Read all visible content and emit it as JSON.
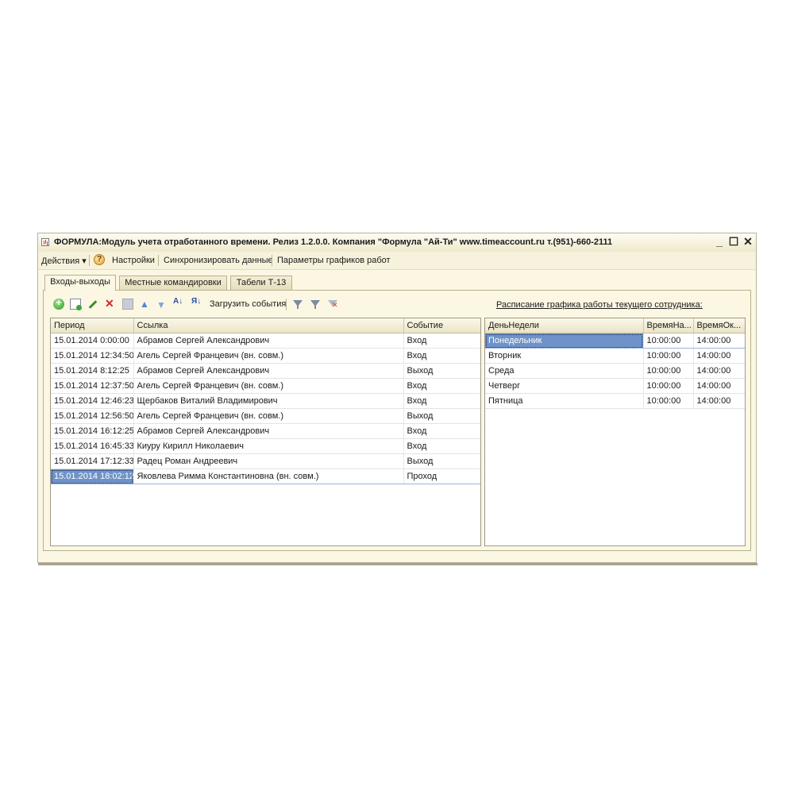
{
  "window": {
    "title": "ФОРМУЛА:Модуль учета отработанного времени. Релиз 1.2.0.0. Компания \"Формула \"Ай-Ти\" www.timeaccount.ru т.(951)-660-2111",
    "controls": {
      "minimize": "_",
      "maximize": "☐",
      "close": "✕"
    }
  },
  "menu": {
    "actions": "Действия ▾",
    "help_icon": "?",
    "settings": "Настройки",
    "sync": "Синхронизировать данные",
    "schedule_params": "Параметры графиков работ"
  },
  "tabs": [
    {
      "label": "Входы-выходы",
      "active": true
    },
    {
      "label": "Местные командировки",
      "active": false
    },
    {
      "label": "Табели Т-13",
      "active": false
    }
  ],
  "toolbar": {
    "icons": [
      "add-icon",
      "copy-icon",
      "edit-icon",
      "delete-icon",
      "grid-icon",
      "move-up-icon",
      "move-down-icon",
      "sort-asc-icon",
      "sort-desc-icon",
      "filter-icon",
      "filter-settings-icon",
      "filter-clear-icon"
    ],
    "load_events": "Загрузить события",
    "sort_asc_glyph": "А↓",
    "sort_desc_glyph": "Я↓"
  },
  "schedule_link": "Расписание графика работы текущего сотрудника:",
  "events_table": {
    "columns": [
      "Период",
      "Ссылка",
      "Событие"
    ],
    "rows": [
      [
        "15.01.2014 0:00:00",
        "Абрамов Сергей Александрович",
        "Вход"
      ],
      [
        "15.01.2014 12:34:50",
        "Агель Сергей Францевич (вн. совм.)",
        "Вход"
      ],
      [
        "15.01.2014 8:12:25",
        "Абрамов Сергей Александрович",
        "Выход"
      ],
      [
        "15.01.2014 12:37:50",
        "Агель Сергей Францевич (вн. совм.)",
        "Вход"
      ],
      [
        "15.01.2014 12:46:23",
        "Щербаков Виталий Владимирович",
        "Вход"
      ],
      [
        "15.01.2014 12:56:50",
        "Агель Сергей Францевич (вн. совм.)",
        "Выход"
      ],
      [
        "15.01.2014 16:12:25",
        "Абрамов Сергей Александрович",
        "Вход"
      ],
      [
        "15.01.2014 16:45:33",
        "Киуру Кирилл Николаевич",
        "Вход"
      ],
      [
        "15.01.2014 17:12:33",
        "Радец Роман Андреевич",
        "Выход"
      ],
      [
        "15.01.2014 18:02:12",
        "Яковлева Римма Константиновна (вн. совм.)",
        "Проход"
      ]
    ],
    "selected_row": 9
  },
  "schedule_table": {
    "columns": [
      "ДеньНедели",
      "ВремяНа...",
      "ВремяОк..."
    ],
    "rows": [
      [
        "Понедельник",
        "10:00:00",
        "14:00:00"
      ],
      [
        "Вторник",
        "10:00:00",
        "14:00:00"
      ],
      [
        "Среда",
        "10:00:00",
        "14:00:00"
      ],
      [
        "Четверг",
        "10:00:00",
        "14:00:00"
      ],
      [
        "Пятница",
        "10:00:00",
        "14:00:00"
      ]
    ],
    "selected_row": 0
  },
  "colors": {
    "window_bg": "#fbf7e3",
    "selection": "#6f93c8",
    "border": "#b7b090"
  }
}
